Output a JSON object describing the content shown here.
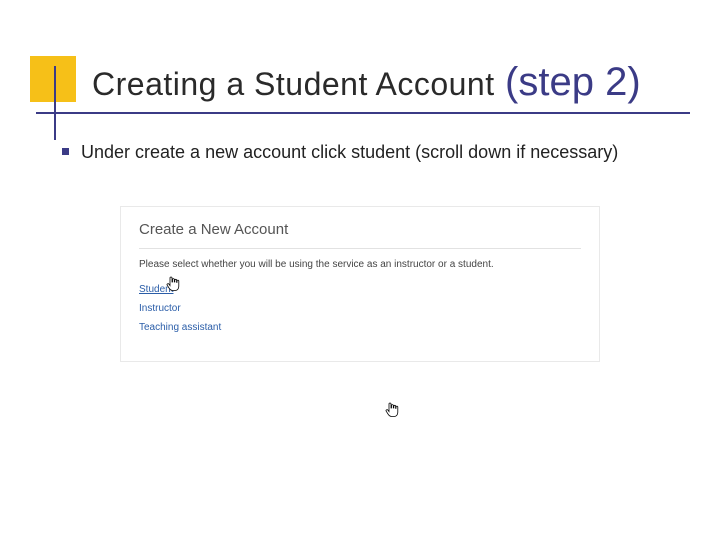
{
  "title": {
    "main": "Creating a Student Account",
    "step": "(step 2)"
  },
  "bullet": {
    "text": "Under create a new account click student (scroll down if necessary)"
  },
  "screenshot": {
    "heading": "Create a New Account",
    "prompt": "Please select whether you will be using the service as an instructor or a student.",
    "links": {
      "student": "Student",
      "instructor": "Instructor",
      "ta": "Teaching assistant"
    }
  }
}
